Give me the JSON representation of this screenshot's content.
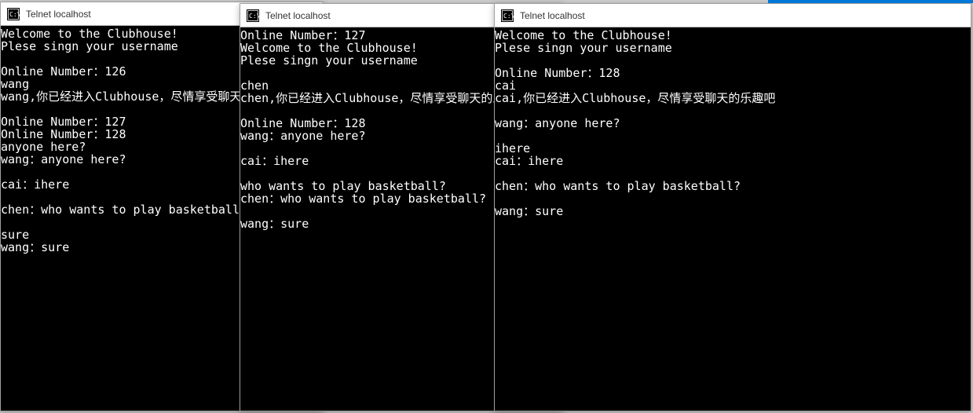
{
  "top_accent_color": "#0078d7",
  "windows": [
    {
      "title": "Telnet localhost",
      "icon": "cmd-icon",
      "lines": [
        "Welcome to the Clubhouse!",
        "Plese singn your username",
        "",
        "Online Number：126",
        "wang",
        "wang,你已经进入Clubhouse，尽情享受聊天的乐趣吧",
        "",
        "Online Number：127",
        "Online Number：128",
        "anyone here?",
        "wang：anyone here?",
        "",
        "cai：ihere",
        "",
        "chen：who wants to play basketball?",
        "",
        "sure",
        "wang：sure"
      ]
    },
    {
      "title": "Telnet localhost",
      "icon": "cmd-icon",
      "lines": [
        "Online Number：127",
        "Welcome to the Clubhouse!",
        "Plese singn your username",
        "",
        "chen",
        "chen,你已经进入Clubhouse，尽情享受聊天的乐趣吧",
        "",
        "Online Number：128",
        "wang：anyone here?",
        "",
        "cai：ihere",
        "",
        "who wants to play basketball?",
        "chen：who wants to play basketball?",
        "",
        "wang：sure"
      ]
    },
    {
      "title": "Telnet localhost",
      "icon": "cmd-icon",
      "lines": [
        "Welcome to the Clubhouse!",
        "Plese singn your username",
        "",
        "Online Number：128",
        "cai",
        "cai,你已经进入Clubhouse，尽情享受聊天的乐趣吧",
        "",
        "wang：anyone here?",
        "",
        "ihere",
        "cai：ihere",
        "",
        "chen：who wants to play basketball?",
        "",
        "wang：sure"
      ]
    }
  ]
}
